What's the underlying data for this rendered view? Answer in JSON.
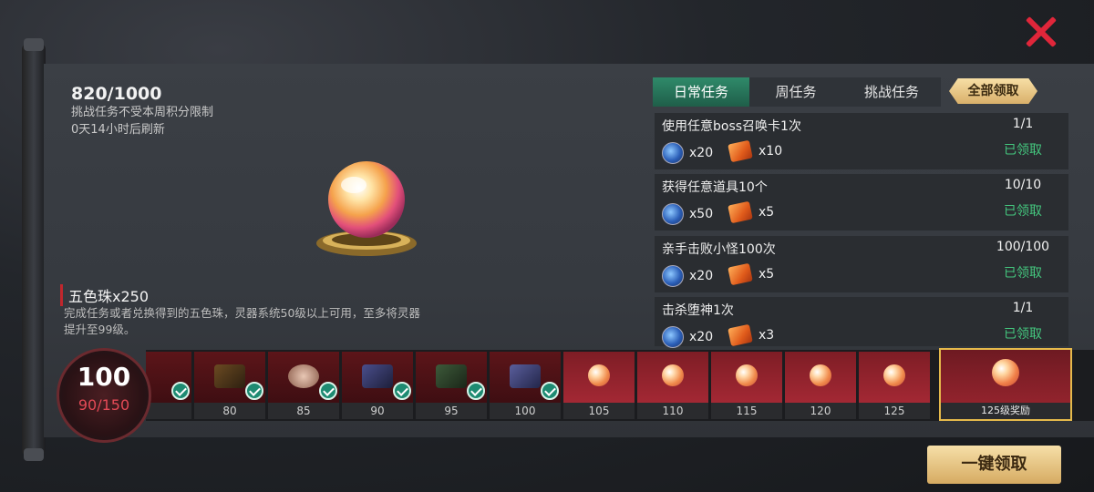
{
  "header": {
    "points": "820/1000",
    "note1": "挑战任务不受本周积分限制",
    "note2": "0天14小时后刷新"
  },
  "item": {
    "name": "五色珠x250",
    "desc": "完成任务或者兑换得到的五色珠，灵器系统50级以上可用，至多将灵器提升至99级。"
  },
  "tabs": [
    {
      "label": "日常任务"
    },
    {
      "label": "周任务"
    },
    {
      "label": "挑战任务"
    }
  ],
  "claim_all_label": "全部领取",
  "tasks": [
    {
      "name": "使用任意boss召唤卡1次",
      "progress": "1/1",
      "status": "已领取",
      "gem_qty": "x20",
      "box_qty": "x10"
    },
    {
      "name": "获得任意道具10个",
      "progress": "10/10",
      "status": "已领取",
      "gem_qty": "x50",
      "box_qty": "x5"
    },
    {
      "name": "亲手击败小怪100次",
      "progress": "100/100",
      "status": "已领取",
      "gem_qty": "x20",
      "box_qty": "x5"
    },
    {
      "name": "击杀堕神1次",
      "progress": "1/1",
      "status": "已领取",
      "gem_qty": "x20",
      "box_qty": "x3"
    }
  ],
  "level": {
    "current": "100",
    "exp": "90/150"
  },
  "track": [
    {
      "label": "80"
    },
    {
      "label": "85"
    },
    {
      "label": "90"
    },
    {
      "label": "95"
    },
    {
      "label": "100"
    },
    {
      "label": "105"
    },
    {
      "label": "110"
    },
    {
      "label": "115"
    },
    {
      "label": "120"
    },
    {
      "label": "125"
    }
  ],
  "final_reward": {
    "label": "125级奖励"
  },
  "one_key_label": "一键领取",
  "colors": {
    "accent_green": "#44c77e",
    "accent_red": "#e0263a",
    "gold": "#e5b94b"
  }
}
